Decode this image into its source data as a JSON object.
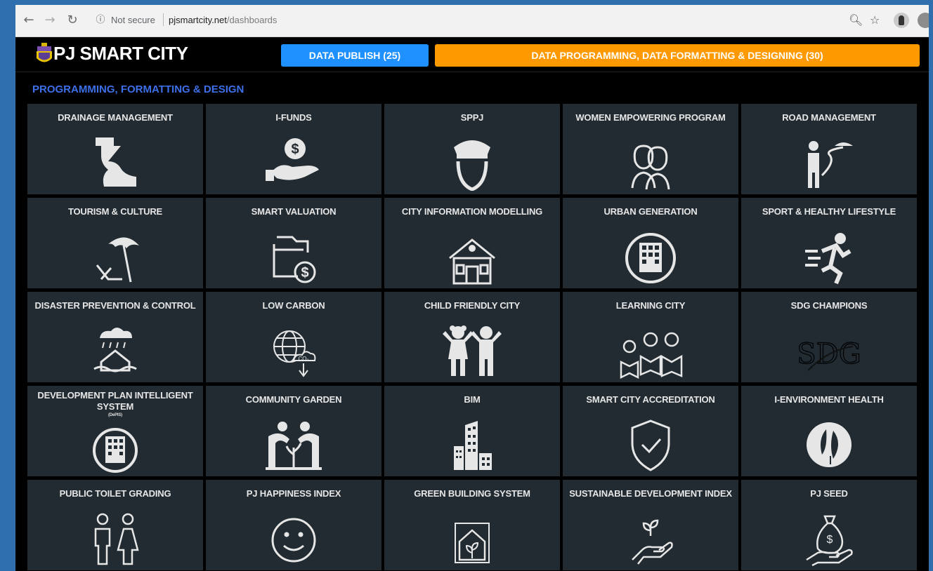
{
  "browser": {
    "not_secure": "Not secure",
    "url_host": "pjsmartcity.net",
    "url_path": "/dashboards"
  },
  "header": {
    "app_title": "PJ SMART CITY",
    "data_publish_label": "DATA PUBLISH (25)",
    "data_programming_label": "DATA PROGRAMMING, DATA FORMATTING & DESIGNING (30)"
  },
  "section": {
    "title": "PROGRAMMING, FORMATTING & DESIGN"
  },
  "colors": {
    "publish_button": "#1e90ff",
    "programming_button": "#ff9900",
    "section_title": "#3d6fe8",
    "tile_background": "#212b31",
    "page_frame": "#2f6fad"
  },
  "tiles": [
    {
      "title": "DRAINAGE MANAGEMENT",
      "icon": "drainage-icon"
    },
    {
      "title": "I-FUNDS",
      "icon": "money-hand-icon"
    },
    {
      "title": "SPPJ",
      "icon": "police-officer-icon"
    },
    {
      "title": "WOMEN EMPOWERING PROGRAM",
      "icon": "women-icon"
    },
    {
      "title": "ROAD MANAGEMENT",
      "icon": "road-worker-icon"
    },
    {
      "title": "TOURISM & CULTURE",
      "icon": "beach-umbrella-icon"
    },
    {
      "title": "SMART VALUATION",
      "icon": "folder-dollar-icon"
    },
    {
      "title": "CITY INFORMATION MODELLING",
      "icon": "building-model-icon"
    },
    {
      "title": "URBAN GENERATION",
      "icon": "urban-building-icon"
    },
    {
      "title": "SPORT & HEALTHY LIFESTYLE",
      "icon": "runner-icon"
    },
    {
      "title": "DISASTER PREVENTION & CONTROL",
      "icon": "flood-house-icon"
    },
    {
      "title": "LOW CARBON",
      "icon": "globe-co2-icon"
    },
    {
      "title": "CHILD FRIENDLY CITY",
      "icon": "children-icon"
    },
    {
      "title": "LEARNING CITY",
      "icon": "readers-icon"
    },
    {
      "title": "SDG CHAMPIONS",
      "icon": "sdg-icon"
    },
    {
      "title": "DEVELOPMENT PLAN INTELLIGENT SYSTEM",
      "subtitle": "(DePIS)",
      "icon": "plan-building-icon"
    },
    {
      "title": "COMMUNITY GARDEN",
      "icon": "gardeners-icon"
    },
    {
      "title": "BIM",
      "icon": "skyscraper-icon"
    },
    {
      "title": "SMART CITY ACCREDITATION",
      "icon": "shield-check-icon"
    },
    {
      "title": "I-ENVIRONMENT HEALTH",
      "icon": "leaf-icon"
    },
    {
      "title": "PUBLIC TOILET GRADING",
      "icon": "toilet-people-icon"
    },
    {
      "title": "PJ HAPPINESS INDEX",
      "icon": "smiley-icon"
    },
    {
      "title": "GREEN BUILDING SYSTEM",
      "icon": "green-house-icon"
    },
    {
      "title": "SUSTAINABLE DEVELOPMENT INDEX",
      "icon": "sprout-hand-icon"
    },
    {
      "title": "PJ SEED",
      "icon": "money-bag-icon"
    }
  ]
}
